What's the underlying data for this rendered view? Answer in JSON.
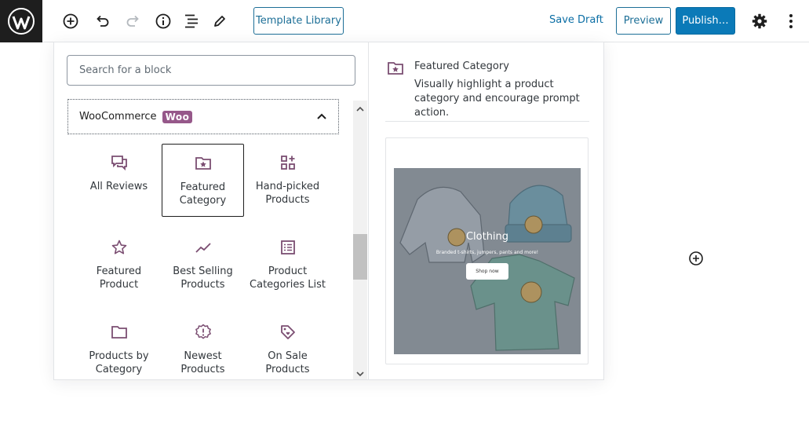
{
  "toolbar": {
    "template_library_label": "Template Library",
    "save_draft_label": "Save Draft",
    "preview_label": "Preview",
    "publish_label": "Publish…",
    "accent_color": "#0b7ab8"
  },
  "inserter": {
    "search_placeholder": "Search for a block",
    "panel_title": "WooCommerce",
    "panel_badge": "Woo",
    "badge_color": "#96588a",
    "blocks": [
      {
        "label": "All Reviews",
        "icon": "reviews-icon"
      },
      {
        "label": "Featured Category",
        "icon": "folder-star-icon",
        "selected": true
      },
      {
        "label": "Hand-picked Products",
        "icon": "grid-plus-icon"
      },
      {
        "label": "Featured Product",
        "icon": "star-icon"
      },
      {
        "label": "Best Selling Products",
        "icon": "trending-up-icon"
      },
      {
        "label": "Product Categories List",
        "icon": "list-icon"
      },
      {
        "label": "Products by Category",
        "icon": "folder-icon"
      },
      {
        "label": "Newest Products",
        "icon": "new-badge-icon"
      },
      {
        "label": "On Sale Products",
        "icon": "tag-icon"
      }
    ]
  },
  "preview": {
    "title": "Featured Category",
    "description": "Visually highlight a product category and encourage prompt action.",
    "image_title": "Clothing",
    "image_subtitle": "Branded t-shirts, jumpers, pants and more!",
    "image_button": "Shop now"
  }
}
